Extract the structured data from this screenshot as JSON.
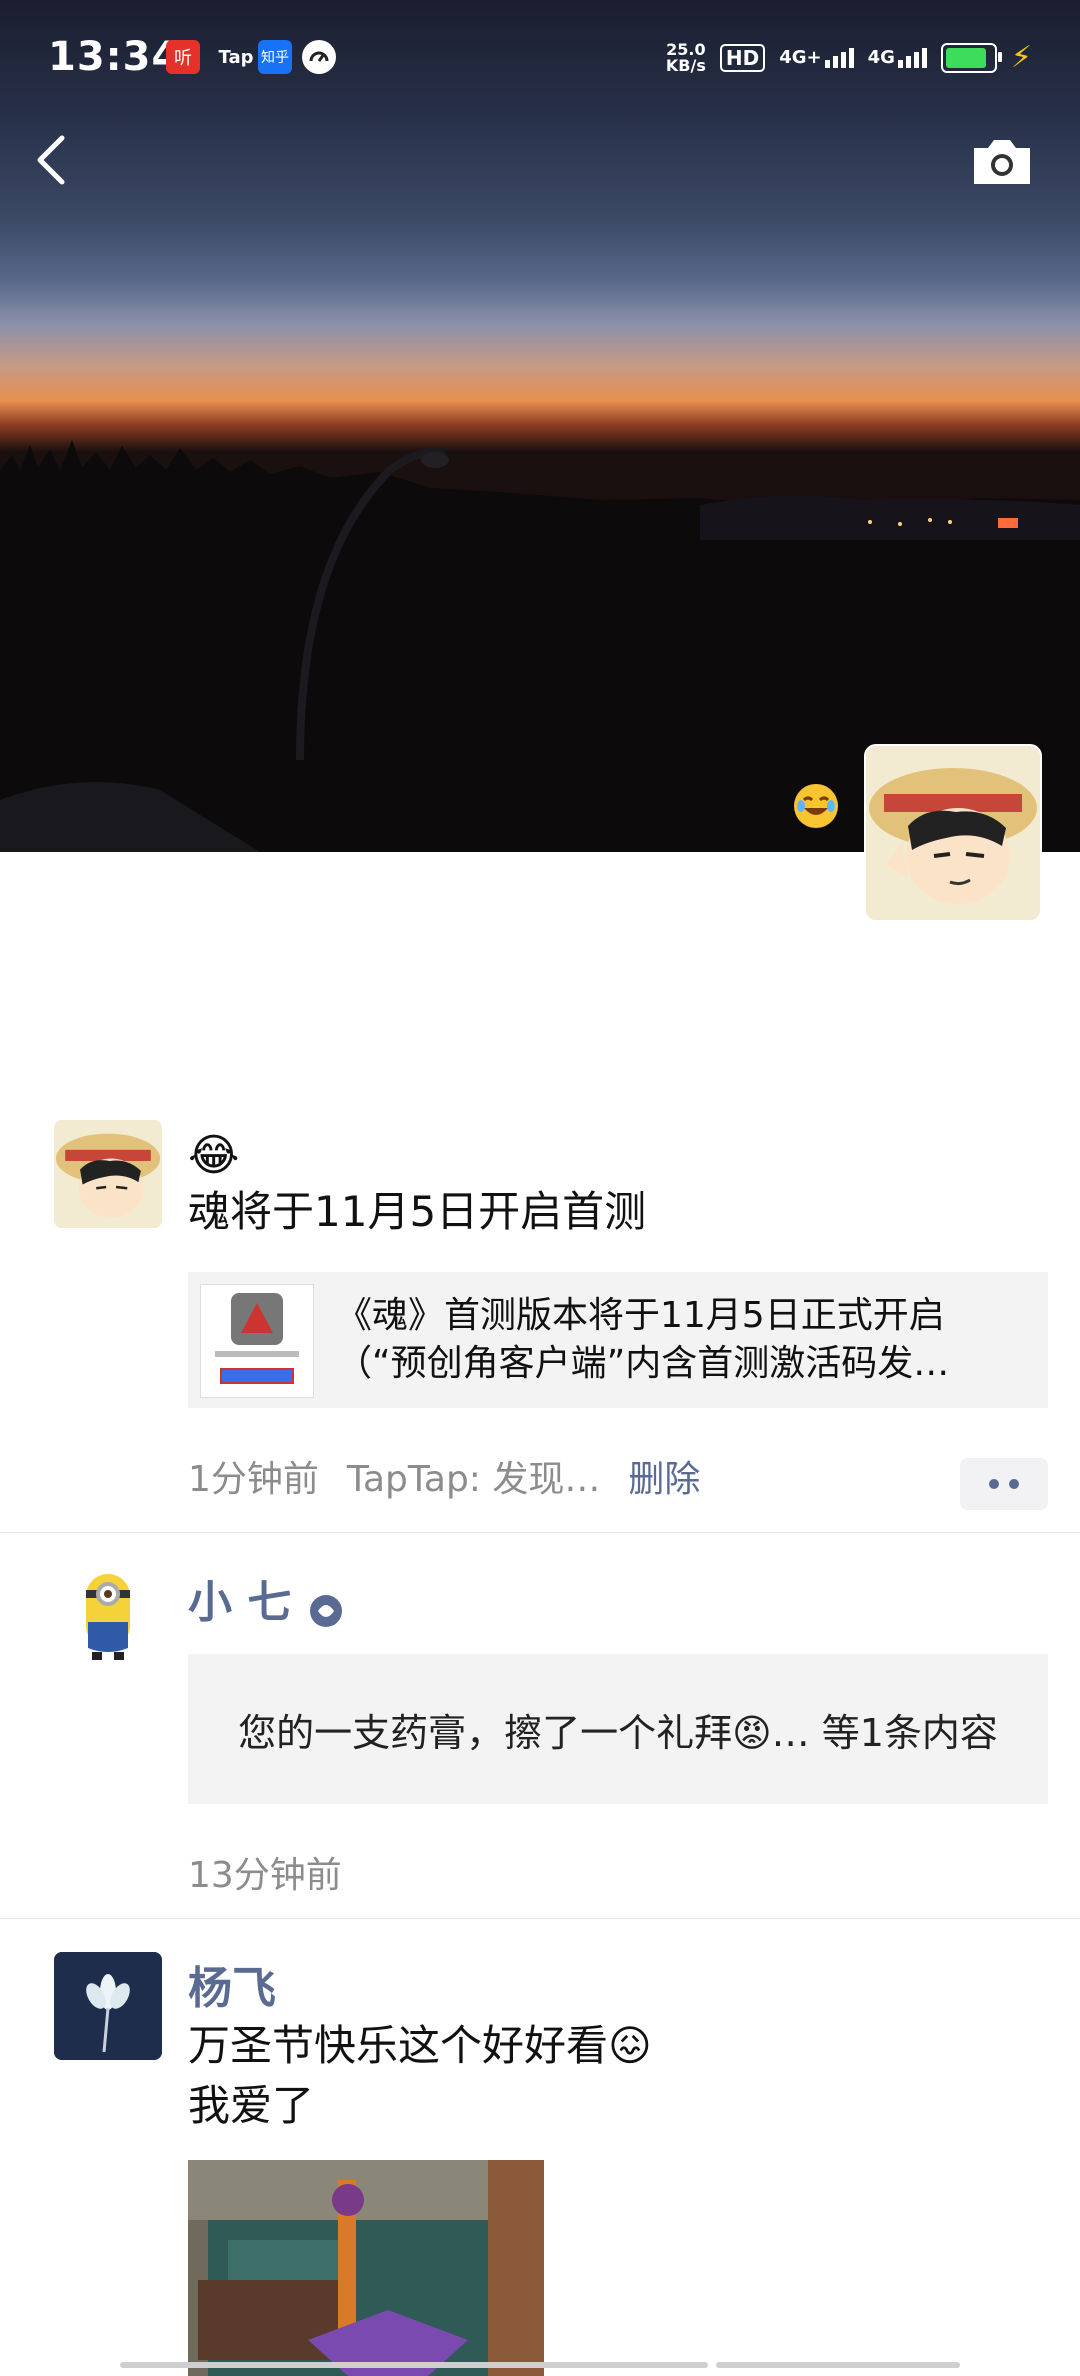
{
  "status_bar": {
    "time": "13:34",
    "notif_icons": [
      "听",
      "Tap",
      "知乎"
    ],
    "net_speed_value": "25.0",
    "net_speed_unit": "KB/s",
    "hd_label": "HD",
    "sim1_label": "4G+",
    "sim2_label": "4G"
  },
  "header": {
    "back_icon": "chevron-left-icon",
    "camera_icon": "camera-icon"
  },
  "posts": [
    {
      "emoji": "😂",
      "text": "魂将于11月5日开启首测",
      "link_card": {
        "title_line1": "《魂》首测版本将于11月5日正式开启",
        "title_line2": "（“预创角客户端”内含首测激活码发…"
      },
      "time": "1分钟前",
      "source": "TapTap: 发现…",
      "delete_label": "删除"
    },
    {
      "nickname": "小 七",
      "quote": "您的一支药膏，擦了一个礼拜😡…  等1条内容",
      "time": "13分钟前"
    },
    {
      "nickname": "杨飞",
      "text_line1": "万圣节快乐这个好好看😖",
      "text_line2": "我爱了"
    }
  ],
  "colors": {
    "nickname": "#5a6b93",
    "meta": "#8c8c8c",
    "card_bg": "#f3f3f4"
  }
}
